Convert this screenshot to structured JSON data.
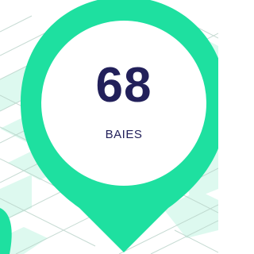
{
  "stat": {
    "value": "68",
    "label": "BAIES"
  },
  "colors": {
    "pin": "#1ee0a0",
    "text": "#22205a",
    "map_tile": "#d2f7ea",
    "map_line": "#b8d2c8"
  },
  "icons": {
    "pin": "map-pin-icon"
  }
}
